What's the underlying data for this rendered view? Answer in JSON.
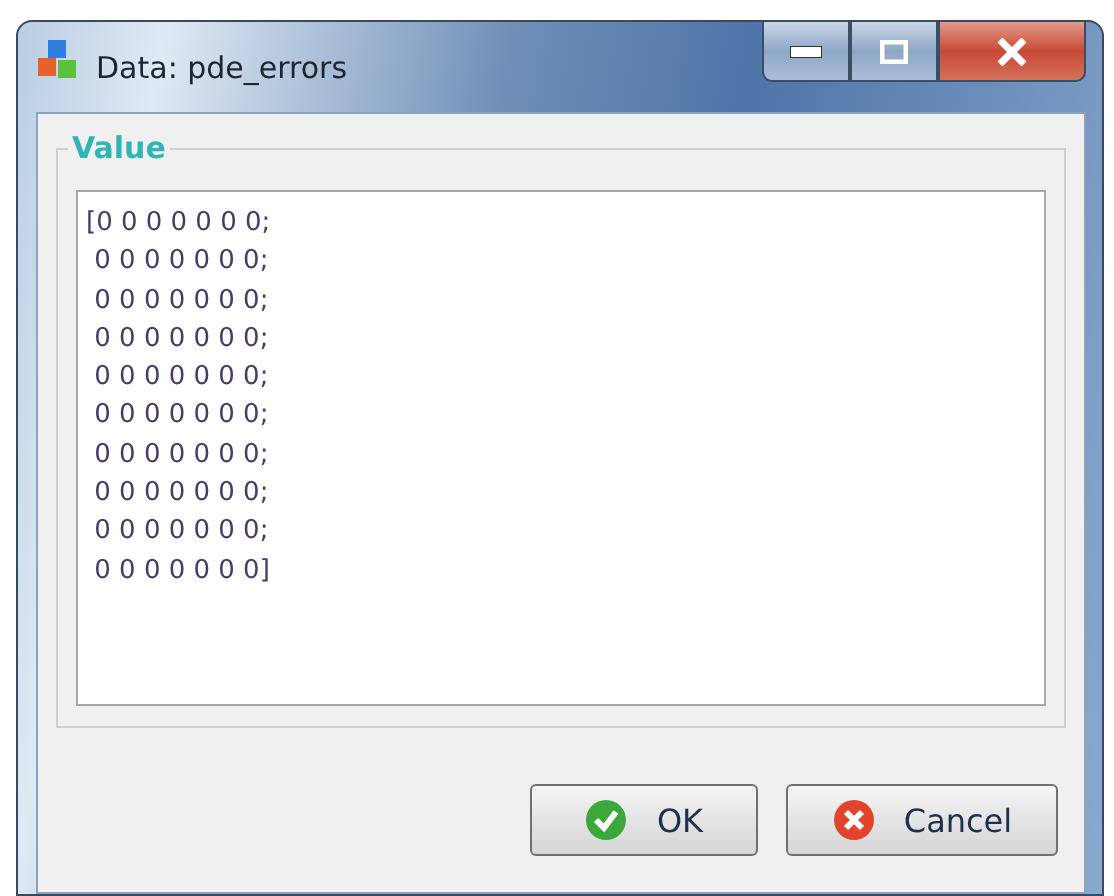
{
  "window": {
    "title": "Data: pde_errors",
    "controls": [
      {
        "kind": "minimize"
      },
      {
        "kind": "maximize"
      },
      {
        "kind": "close"
      }
    ]
  },
  "group": {
    "legend": "Value",
    "value": "[0 0 0 0 0 0 0;\n 0 0 0 0 0 0 0;\n 0 0 0 0 0 0 0;\n 0 0 0 0 0 0 0;\n 0 0 0 0 0 0 0;\n 0 0 0 0 0 0 0;\n 0 0 0 0 0 0 0;\n 0 0 0 0 0 0 0;\n 0 0 0 0 0 0 0;\n 0 0 0 0 0 0 0]"
  },
  "buttons": [
    {
      "kind": "ok",
      "label": "OK"
    },
    {
      "kind": "cancel",
      "label": "Cancel"
    }
  ]
}
